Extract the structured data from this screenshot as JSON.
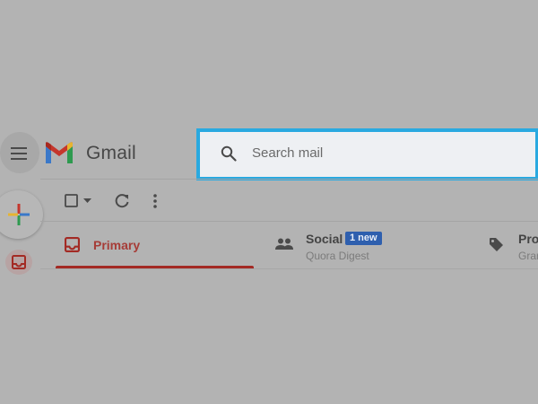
{
  "app": {
    "name": "Gmail"
  },
  "search": {
    "placeholder": "Search mail"
  },
  "toolbar": {
    "select_icon": "checkbox-icon",
    "select_menu_icon": "chevron-down-icon",
    "refresh_icon": "refresh-icon",
    "more_icon": "more-vert-icon"
  },
  "sidebar": {
    "menu_icon": "menu-icon",
    "compose_icon": "compose-plus-icon",
    "inbox_icon": "inbox-icon"
  },
  "tabs": [
    {
      "label": "Primary",
      "icon": "inbox-icon",
      "active": true
    },
    {
      "label": "Social",
      "badge": "1 new",
      "subtitle": "Quora Digest",
      "icon": "people-icon"
    },
    {
      "label": "Pro",
      "subtitle": "Grar",
      "icon": "tag-icon"
    }
  ],
  "colors": {
    "search_highlight": "#29a9e0",
    "active_tab": "#a32a24",
    "badge": "#2e5fae"
  }
}
